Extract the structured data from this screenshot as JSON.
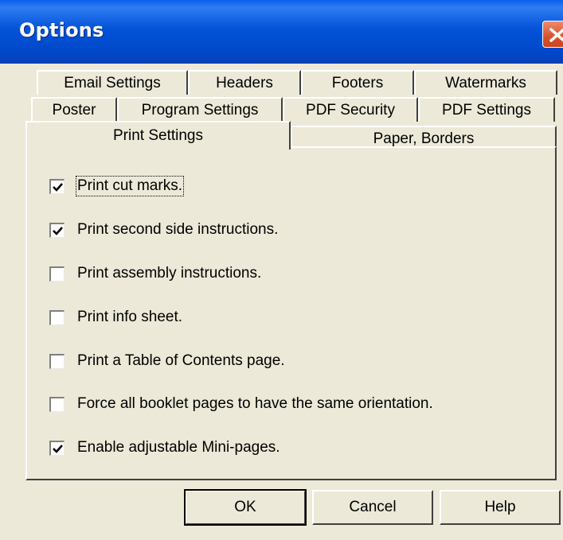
{
  "window": {
    "title": "Options",
    "close_icon": "close-icon"
  },
  "tabs": {
    "row1": [
      "Email Settings",
      "Headers",
      "Footers",
      "Watermarks"
    ],
    "row2": [
      "Poster",
      "Program Settings",
      "PDF Security",
      "PDF Settings"
    ],
    "row3": [
      "Print Settings",
      "Paper, Borders"
    ],
    "selected": "Print Settings"
  },
  "options": [
    {
      "label": "Print cut marks.",
      "checked": true
    },
    {
      "label": "Print second side instructions.",
      "checked": true
    },
    {
      "label": "Print assembly instructions.",
      "checked": false
    },
    {
      "label": "Print info sheet.",
      "checked": false
    },
    {
      "label": "Print a Table of Contents page.",
      "checked": false
    },
    {
      "label": "Force all booklet pages to have the same orientation.",
      "checked": false
    },
    {
      "label": "Enable adjustable Mini-pages.",
      "checked": true
    }
  ],
  "buttons": {
    "ok": "OK",
    "cancel": "Cancel",
    "help": "Help"
  },
  "colors": {
    "titlebar": "#0453d8",
    "face": "#ece9d8",
    "close": "#d9532c"
  }
}
